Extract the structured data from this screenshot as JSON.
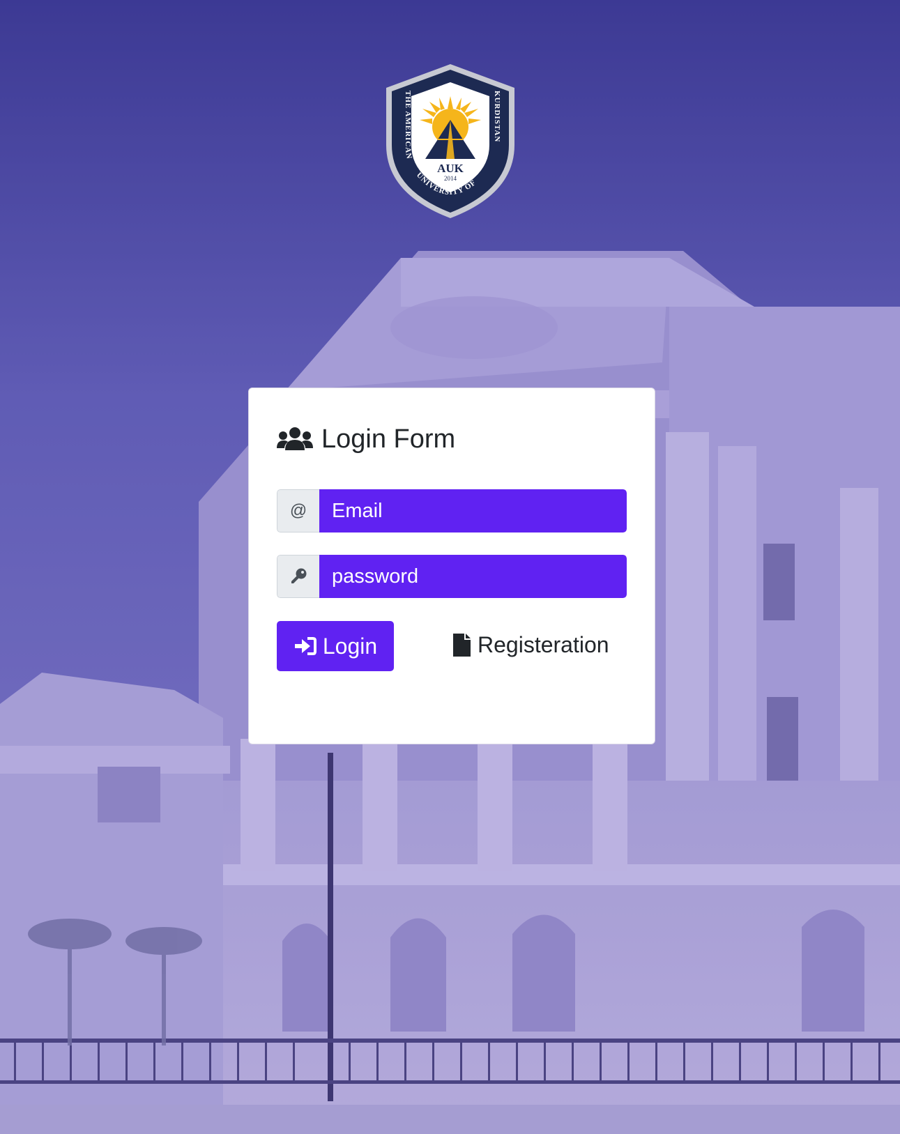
{
  "logo": {
    "name": "the-american-university-of-kurdistan-logo",
    "arc_left": "THE AMERICAN",
    "arc_bottom": "UNIVERSITY OF",
    "arc_right": "KURDISTAN",
    "abbr": "AUK",
    "year": "2014"
  },
  "login_form": {
    "title": "Login Form",
    "title_icon": "users-icon",
    "email": {
      "addon": "@",
      "placeholder": "Email",
      "value": ""
    },
    "password": {
      "addon_icon": "key-icon",
      "placeholder": "password",
      "value": ""
    },
    "login_button": {
      "label": "Login",
      "icon": "sign-in-icon"
    },
    "register_link": {
      "label": "Registeration",
      "icon": "file-icon"
    }
  },
  "colors": {
    "accent": "#6022f2",
    "overlay": "#5a56b0",
    "card": "#ffffff",
    "text": "#212529",
    "addon_bg": "#e9ecef",
    "logo_navy": "#1d2a52",
    "logo_gold": "#f5b51b"
  }
}
